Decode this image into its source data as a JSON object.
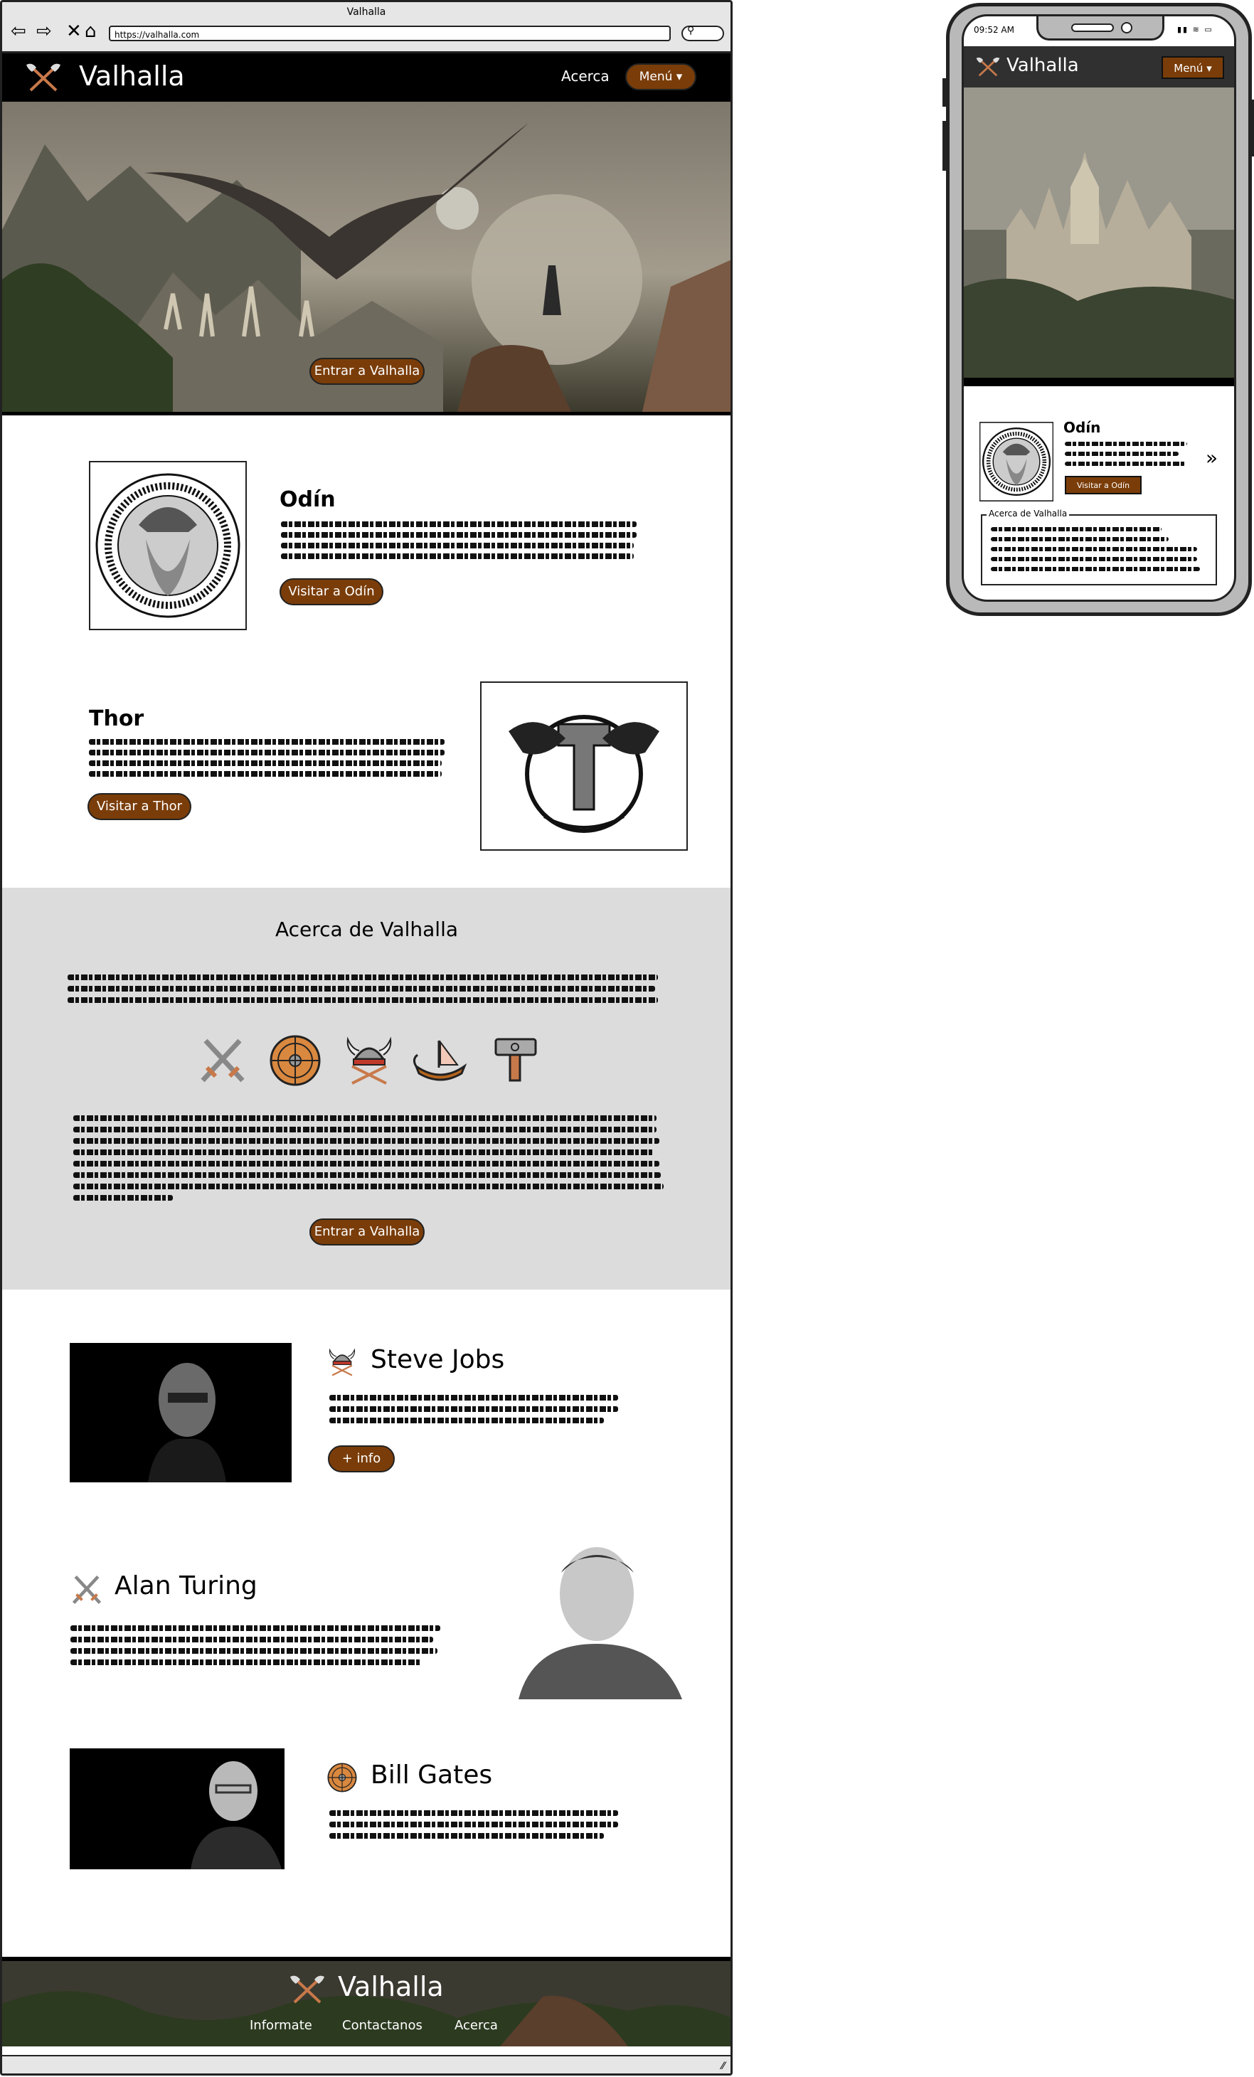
{
  "browser": {
    "window_title": "Valhalla",
    "url": "https://valhalla.com"
  },
  "nav": {
    "brand": "Valhalla",
    "about_link": "Acerca",
    "menu_button": "Menú ▾"
  },
  "hero": {
    "cta": "Entrar a Valhalla"
  },
  "gods": [
    {
      "name": "Odín",
      "button": "Visitar a Odín"
    },
    {
      "name": "Thor",
      "button": "Visitar a Thor"
    }
  ],
  "about": {
    "title": "Acerca de Valhalla",
    "icons": [
      "crossed-swords-icon",
      "viking-shield-icon",
      "viking-helmet-icon",
      "longship-icon",
      "hammer-icon"
    ],
    "cta": "Entrar a Valhalla"
  },
  "people": [
    {
      "name": "Steve Jobs",
      "icon": "viking-helmet-icon",
      "button": "+ info"
    },
    {
      "name": "Alan Turing",
      "icon": "crossed-swords-icon"
    },
    {
      "name": "Bill Gates",
      "icon": "viking-shield-icon"
    }
  ],
  "footer": {
    "brand": "Valhalla",
    "links": [
      "Informate",
      "Contactanos",
      "Acerca"
    ]
  },
  "mobile": {
    "time": "09:52 AM",
    "brand": "Valhalla",
    "menu_button": "Menú ▾",
    "card_title": "Odín",
    "card_button": "Visitar a Odín",
    "about_legend": "Acerca de Valhalla"
  },
  "colors": {
    "accent": "#7a3d09",
    "navbar": "#000000",
    "about_bg": "#dcdcdc"
  }
}
